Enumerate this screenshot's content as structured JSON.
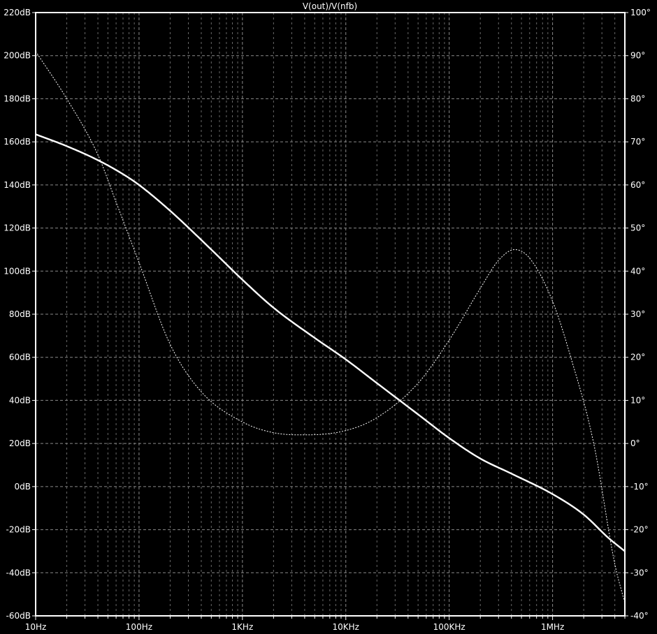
{
  "chart_data": {
    "type": "line",
    "title": "V(out)/V(nfb)",
    "x_scale": "log",
    "xlim": [
      10,
      5000000
    ],
    "x_tick_values": [
      10,
      100,
      1000,
      10000,
      100000,
      1000000
    ],
    "x_tick_labels": [
      "10Hz",
      "100Hz",
      "1KHz",
      "10KHz",
      "100KHz",
      "1MHz"
    ],
    "y_left": {
      "ylim": [
        -60,
        220
      ],
      "tick_values": [
        220,
        200,
        180,
        160,
        140,
        120,
        100,
        80,
        60,
        40,
        20,
        0,
        -20,
        -40,
        -60
      ],
      "tick_labels": [
        "220dB",
        "200dB",
        "180dB",
        "160dB",
        "140dB",
        "120dB",
        "100dB",
        "80dB",
        "60dB",
        "40dB",
        "20dB",
        "0dB",
        "-20dB",
        "-40dB",
        "-60dB"
      ]
    },
    "y_right": {
      "ylim": [
        -40,
        100
      ],
      "tick_values": [
        100,
        90,
        80,
        70,
        60,
        50,
        40,
        30,
        20,
        10,
        0,
        -10,
        -20,
        -30,
        -40
      ],
      "tick_labels": [
        "100°",
        "90°",
        "80°",
        "70°",
        "60°",
        "50°",
        "40°",
        "30°",
        "20°",
        "10°",
        "0°",
        "-10°",
        "-20°",
        "-30°",
        "-40°"
      ]
    },
    "grid": true,
    "colors": {
      "background": "#000000",
      "trace": "#ffffff",
      "grid": "#8a8a8a",
      "frame": "#ffffff"
    },
    "series": [
      {
        "axis": "left",
        "style": "solid",
        "points": [
          [
            10,
            163.5
          ],
          [
            20,
            158
          ],
          [
            40,
            151.5
          ],
          [
            70,
            145
          ],
          [
            100,
            140
          ],
          [
            200,
            128
          ],
          [
            500,
            110
          ],
          [
            1000,
            96
          ],
          [
            2000,
            83
          ],
          [
            5000,
            69
          ],
          [
            10000,
            59
          ],
          [
            20000,
            48
          ],
          [
            50000,
            33.5
          ],
          [
            100000,
            22.5
          ],
          [
            200000,
            13
          ],
          [
            400000,
            6
          ],
          [
            1000000,
            -3.5
          ],
          [
            2000000,
            -13
          ],
          [
            3500000,
            -24
          ],
          [
            5000000,
            -30
          ]
        ]
      },
      {
        "axis": "right",
        "style": "dashed",
        "points": [
          [
            10,
            91
          ],
          [
            20,
            80
          ],
          [
            40,
            67
          ],
          [
            60,
            56
          ],
          [
            100,
            42
          ],
          [
            200,
            23
          ],
          [
            400,
            12
          ],
          [
            1000,
            5
          ],
          [
            2000,
            2.5
          ],
          [
            4000,
            2
          ],
          [
            10000,
            3
          ],
          [
            20000,
            6
          ],
          [
            50000,
            14
          ],
          [
            100000,
            24
          ],
          [
            200000,
            36
          ],
          [
            300000,
            42.5
          ],
          [
            430000,
            45
          ],
          [
            600000,
            43
          ],
          [
            1000000,
            33
          ],
          [
            1500000,
            20
          ],
          [
            2500000,
            0
          ],
          [
            4000000,
            -28
          ],
          [
            5000000,
            -37
          ]
        ]
      }
    ]
  }
}
